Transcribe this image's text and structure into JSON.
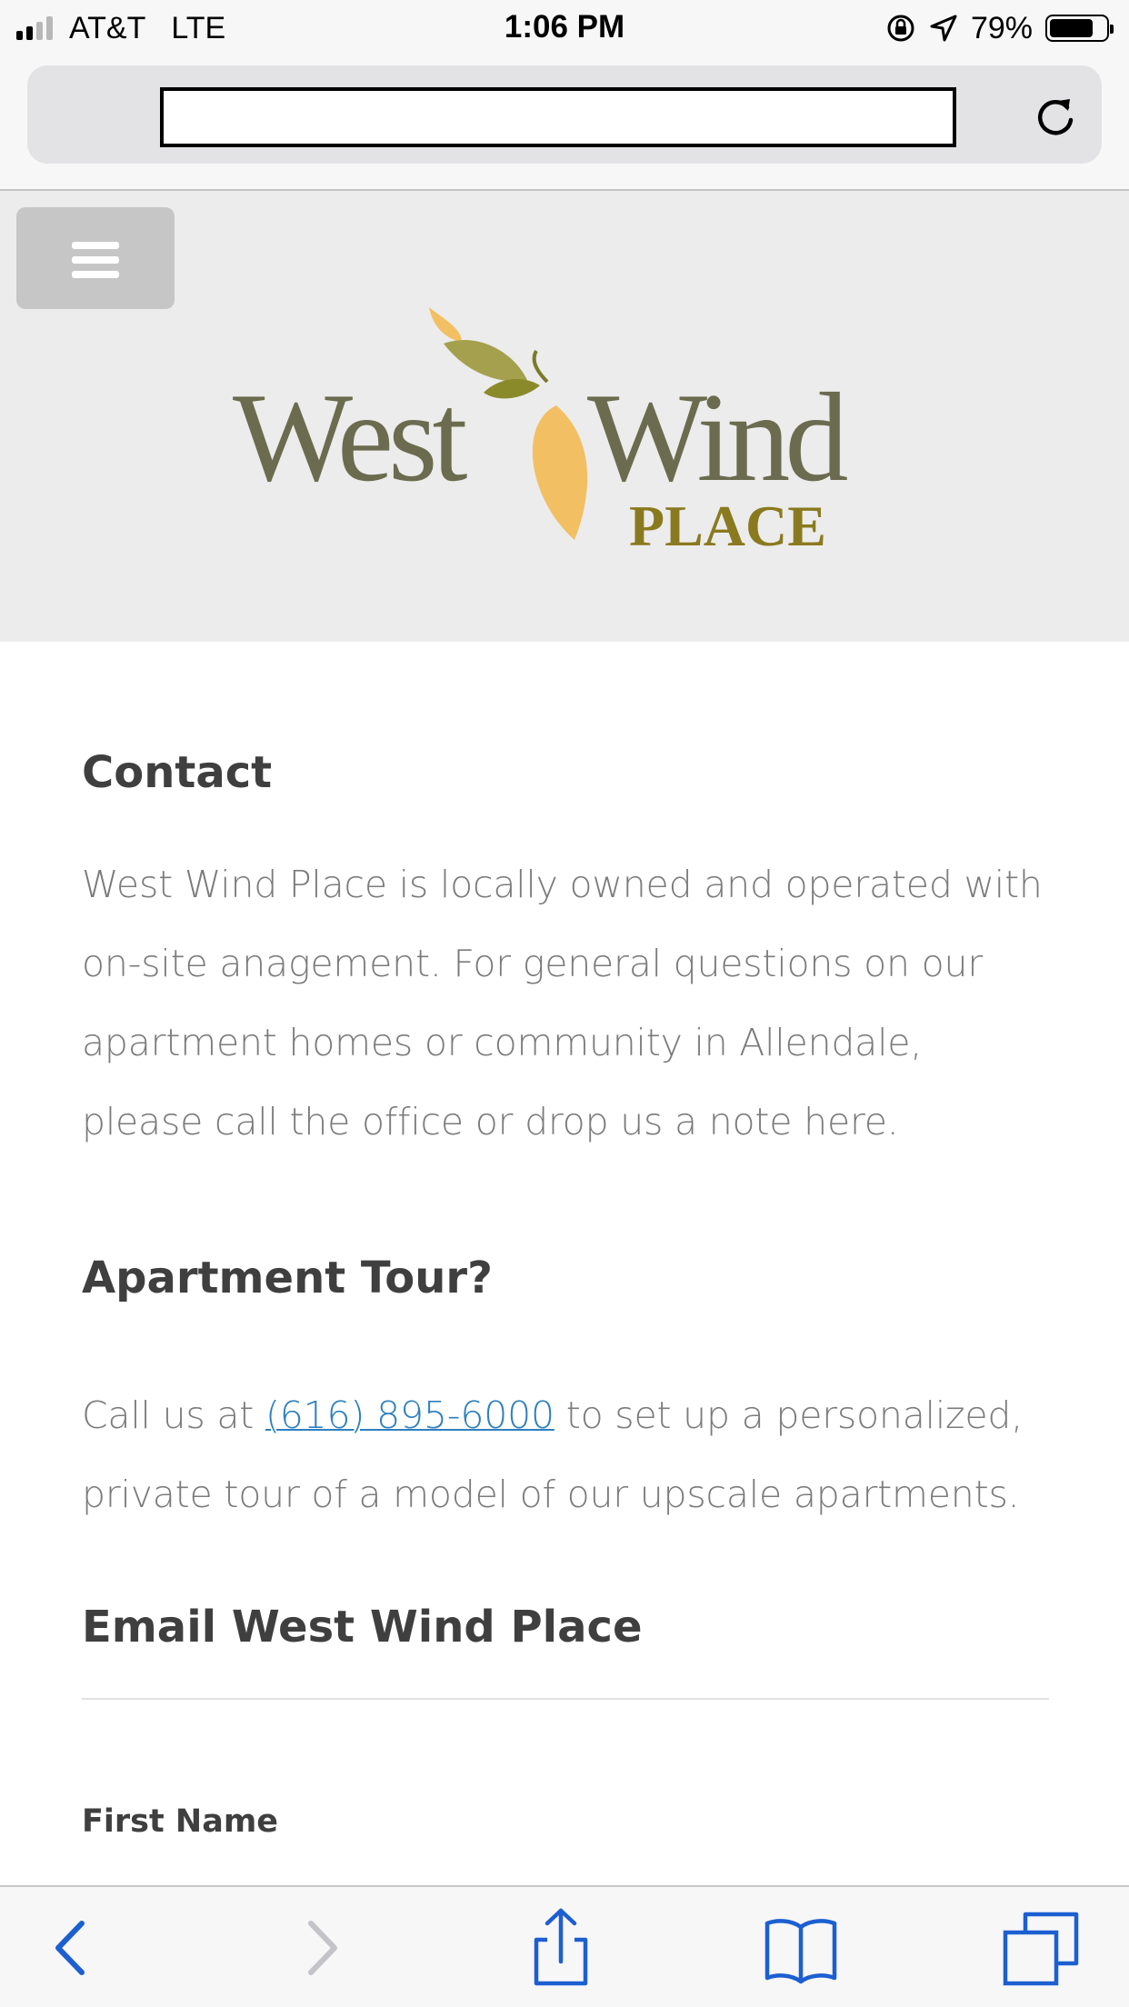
{
  "status_bar": {
    "carrier": "AT&T",
    "network": "LTE",
    "time": "1:06 PM",
    "battery": "79%",
    "battery_level": 0.79
  },
  "browser": {
    "url": "",
    "icons": {
      "reload": "reload-icon",
      "back": "back-chevron-icon",
      "forward": "forward-chevron-icon",
      "share": "share-icon",
      "bookmarks": "bookmarks-icon",
      "tabs": "tabs-icon"
    }
  },
  "header": {
    "logo_text": {
      "west": "West",
      "wind": "Wind",
      "place": "PLACE"
    }
  },
  "contact": {
    "heading": "Contact",
    "body": "West Wind Place is locally owned and operated with on-site anagement. For general questions on our apartment homes or community in Allendale, please call the office or drop us a note here."
  },
  "tour": {
    "heading": "Apartment Tour?",
    "prefix": "Call us at ",
    "phone": "(616) 895-6000",
    "suffix": " to set up a personalized, private tour of a model of our upscale apartments."
  },
  "email": {
    "heading": "Email West Wind Place",
    "first_name_label": "First Name"
  },
  "colors": {
    "link": "#2e7fbf",
    "heading": "#3f3f3f",
    "body_text": "#7b7b7b",
    "header_bg": "#ececec",
    "toolbar_icon": "#1c5fd1",
    "logo_olive": "#6b6b4f",
    "logo_gold": "#8a7a1f",
    "leaf_orange": "#f3bf63"
  }
}
